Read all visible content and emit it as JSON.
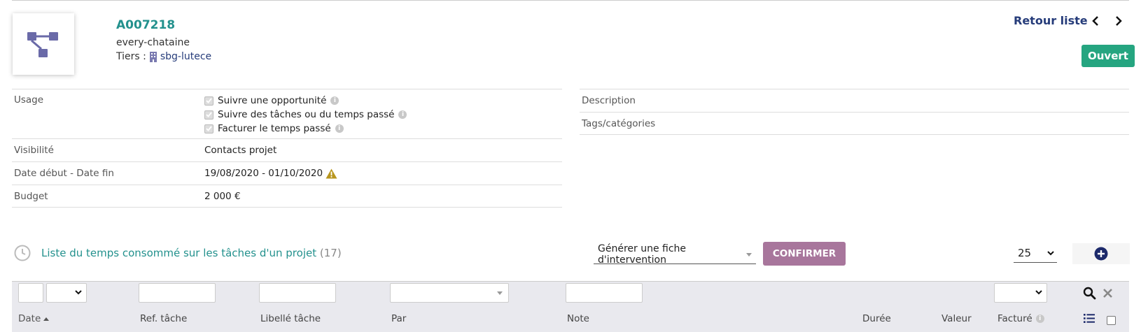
{
  "header": {
    "ref": "A007218",
    "name": "every-chataine",
    "tiers_label": "Tiers :",
    "tiers_value": "sbg-lutece",
    "back_label": "Retour liste",
    "status": "Ouvert"
  },
  "fields": {
    "usage_label": "Usage",
    "usage_options": [
      "Suivre une opportunité",
      "Suivre des tâches ou du temps passé",
      "Facturer le temps passé"
    ],
    "visibility_label": "Visibilité",
    "visibility_value": "Contacts projet",
    "dates_label": "Date début - Date fin",
    "dates_value": "19/08/2020 - 01/10/2020",
    "budget_label": "Budget",
    "budget_value": "2 000 €",
    "description_label": "Description",
    "tags_label": "Tags/catégories"
  },
  "list": {
    "title": "Liste du temps consommé sur les tâches d'un projet",
    "count": "(17)",
    "action_select": "Générer une fiche d'intervention",
    "confirm_label": "CONFIRMER",
    "page_size": "25",
    "columns": {
      "date": "Date",
      "ref_tache": "Ref. tâche",
      "libelle": "Libellé tâche",
      "par": "Par",
      "note": "Note",
      "duree": "Durée",
      "valeur": "Valeur",
      "facture": "Facturé"
    }
  },
  "colors": {
    "accent_teal": "#23918d",
    "link_navy": "#263c7a",
    "status_green": "#25a580",
    "confirm_purple": "#a8769c",
    "logo_purple": "#6a6aa8"
  }
}
